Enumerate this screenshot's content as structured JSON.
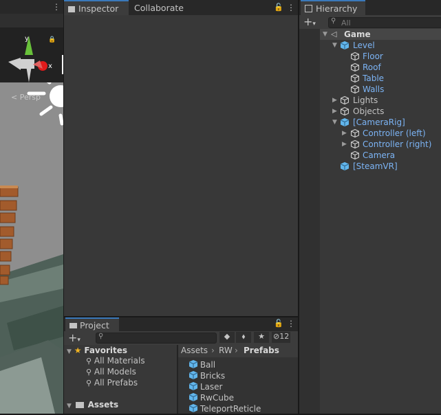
{
  "hierarchy": {
    "tab": "Hierarchy",
    "search_placeholder": "All",
    "root": "Game",
    "items": [
      {
        "label": "Level",
        "prefab": true
      },
      {
        "label": "Floor",
        "prefab": true
      },
      {
        "label": "Roof",
        "prefab": true
      },
      {
        "label": "Table",
        "prefab": true
      },
      {
        "label": "Walls",
        "prefab": true
      },
      {
        "label": "Lights",
        "prefab": false
      },
      {
        "label": "Objects",
        "prefab": false
      },
      {
        "label": "[CameraRig]",
        "prefab": true
      },
      {
        "label": "Controller (left)",
        "prefab": true
      },
      {
        "label": "Controller (right)",
        "prefab": true
      },
      {
        "label": "Camera",
        "prefab": true
      },
      {
        "label": "[SteamVR]",
        "prefab": true
      }
    ]
  },
  "inspector": {
    "tabs": [
      "Inspector",
      "Collaborate"
    ]
  },
  "scene": {
    "persp_label": "Persp",
    "axis_y": "y",
    "axis_x": "x"
  },
  "project": {
    "tab": "Project",
    "hidden_count": "12",
    "favorites_label": "Favorites",
    "favorites": [
      "All Materials",
      "All Models",
      "All Prefabs"
    ],
    "assets_label": "Assets",
    "breadcrumb": [
      "Assets",
      "RW",
      "Prefabs"
    ],
    "files": [
      "Ball",
      "Bricks",
      "Laser",
      "RwCube",
      "TeleportReticle"
    ]
  },
  "colors": {
    "accent": "#3a79bb",
    "prefab_text": "#7cb4f5",
    "cube_blue": "#62b6ec"
  }
}
